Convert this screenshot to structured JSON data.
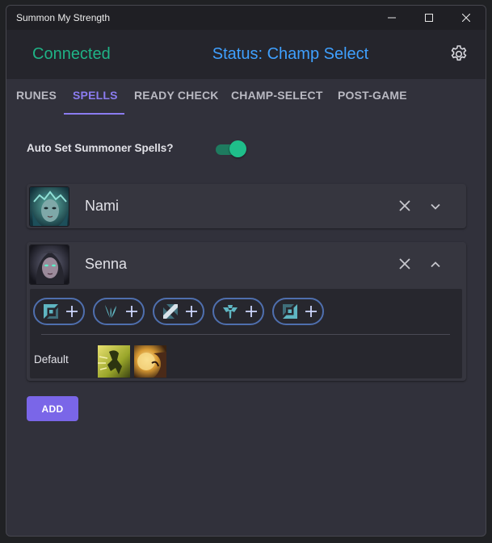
{
  "window": {
    "title": "Summon My Strength"
  },
  "header": {
    "connection": "Connected",
    "status": "Status: Champ Select"
  },
  "tabs": [
    {
      "label": "RUNES"
    },
    {
      "label": "SPELLS"
    },
    {
      "label": "READY CHECK"
    },
    {
      "label": "CHAMP-SELECT"
    },
    {
      "label": "POST-GAME"
    }
  ],
  "active_tab": "SPELLS",
  "auto_set": {
    "label": "Auto Set Summoner Spells?",
    "enabled": true
  },
  "champions": [
    {
      "name": "Nami",
      "expanded": false
    },
    {
      "name": "Senna",
      "expanded": true,
      "roles": [
        "top",
        "jungle",
        "mid",
        "support",
        "bottom"
      ],
      "default_label": "Default",
      "default_spells": [
        "ghost",
        "heal"
      ]
    }
  ],
  "add_button": "ADD",
  "colors": {
    "accent": "#8b7cf0",
    "connected": "#1fb386",
    "status": "#3fa0ff",
    "toggle": "#1fbe8a"
  }
}
